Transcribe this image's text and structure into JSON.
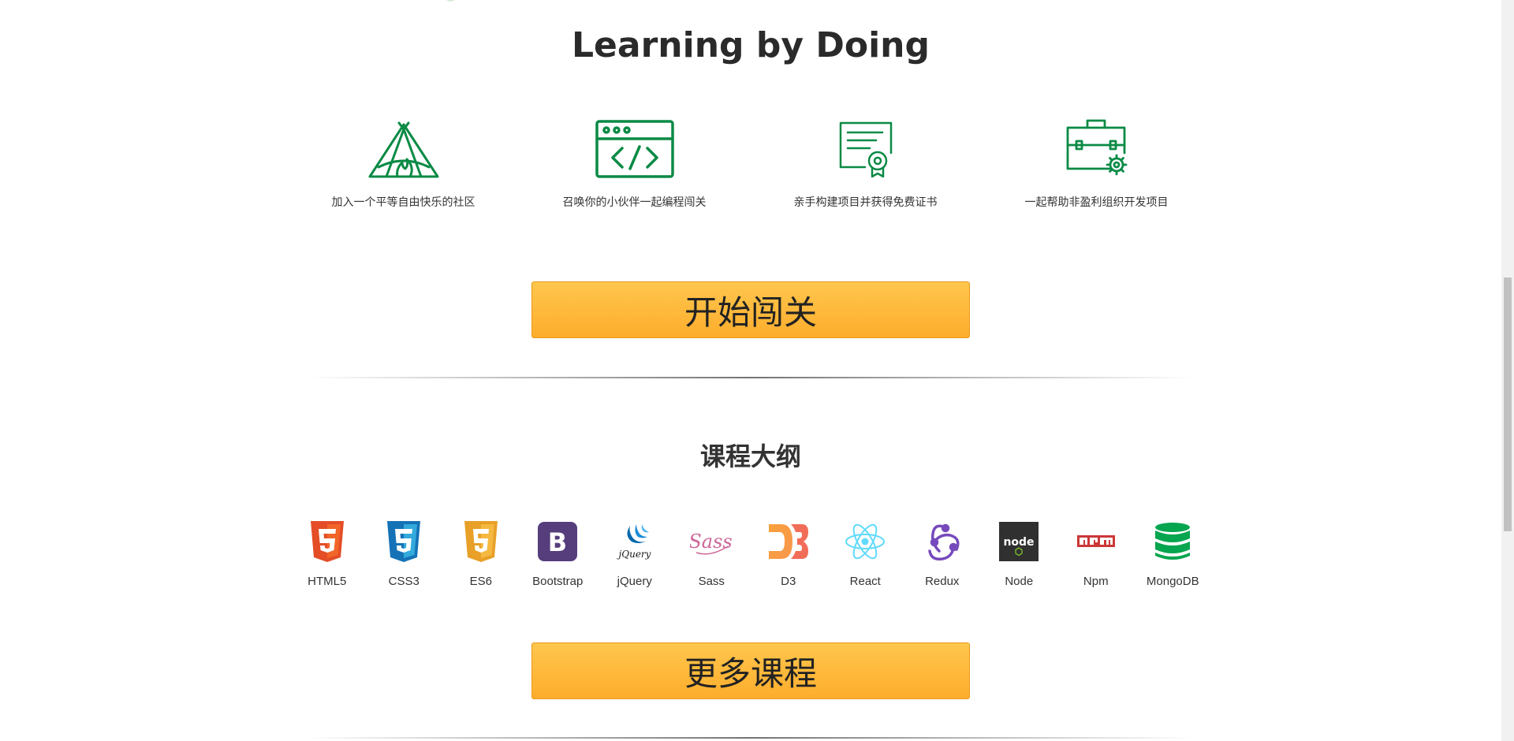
{
  "hero": {
    "title": "Learning by Doing"
  },
  "features": [
    {
      "icon": "tent-campfire-icon",
      "label": "加入一个平等自由快乐的社区"
    },
    {
      "icon": "code-window-icon",
      "label": "召唤你的小伙伴一起编程闯关"
    },
    {
      "icon": "certificate-icon",
      "label": "亲手构建项目并获得免费证书"
    },
    {
      "icon": "briefcase-gear-icon",
      "label": "一起帮助非盈利组织开发项目"
    }
  ],
  "cta_start": {
    "label": "开始闯关"
  },
  "syllabus": {
    "title": "课程大纲",
    "items": [
      {
        "name": "HTML5",
        "icon": "html5-logo-icon"
      },
      {
        "name": "CSS3",
        "icon": "css3-logo-icon"
      },
      {
        "name": "ES6",
        "icon": "es6-logo-icon"
      },
      {
        "name": "Bootstrap",
        "icon": "bootstrap-logo-icon"
      },
      {
        "name": "jQuery",
        "icon": "jquery-logo-icon"
      },
      {
        "name": "Sass",
        "icon": "sass-logo-icon"
      },
      {
        "name": "D3",
        "icon": "d3-logo-icon"
      },
      {
        "name": "React",
        "icon": "react-logo-icon"
      },
      {
        "name": "Redux",
        "icon": "redux-logo-icon"
      },
      {
        "name": "Node",
        "icon": "node-logo-icon"
      },
      {
        "name": "Npm",
        "icon": "npm-logo-icon"
      },
      {
        "name": "MongoDB",
        "icon": "mongodb-logo-icon"
      }
    ]
  },
  "cta_more": {
    "label": "更多课程"
  },
  "colors": {
    "accent_green": "#0a8a45",
    "button_yellow": "#ffb83d"
  }
}
